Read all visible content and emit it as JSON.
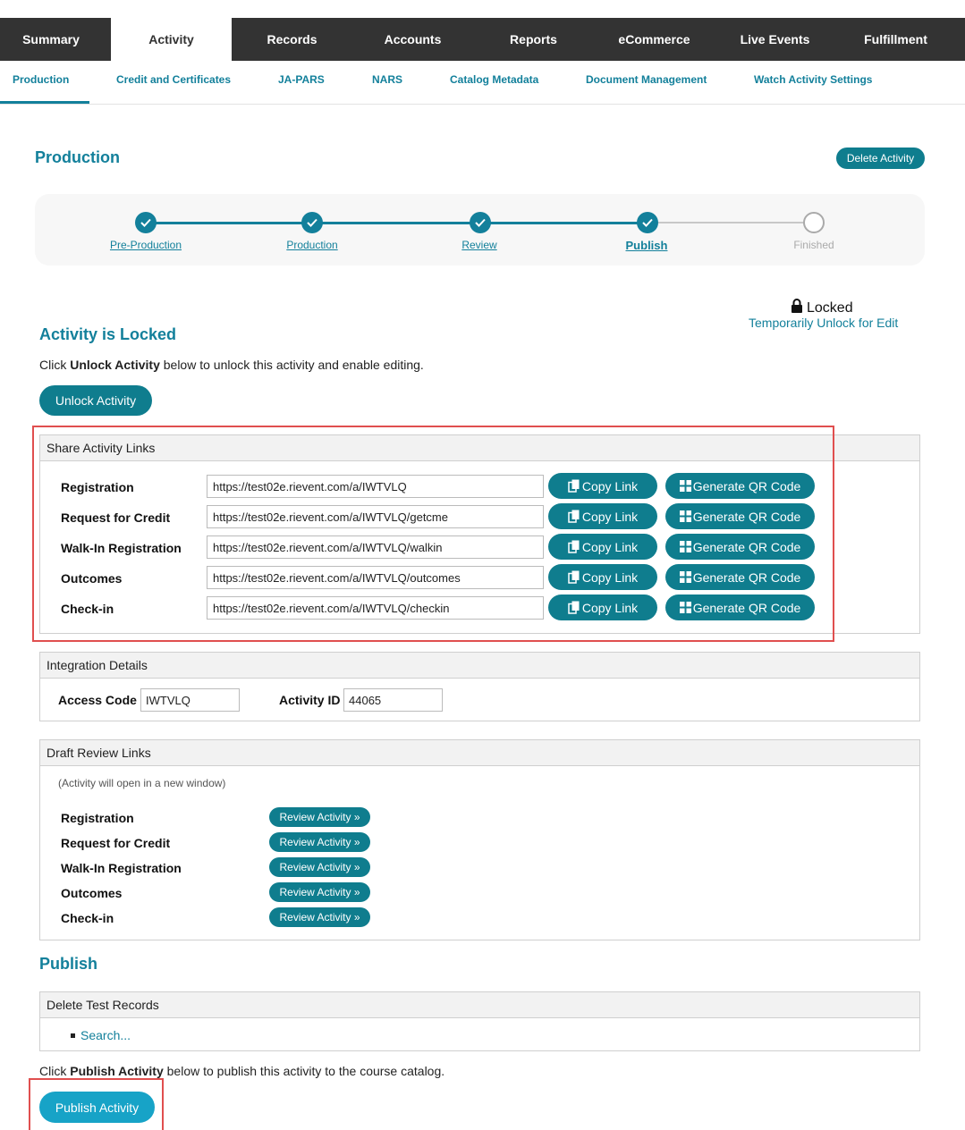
{
  "top_nav": [
    {
      "label": "Summary"
    },
    {
      "label": "Activity",
      "active": true
    },
    {
      "label": "Records"
    },
    {
      "label": "Accounts"
    },
    {
      "label": "Reports"
    },
    {
      "label": "eCommerce"
    },
    {
      "label": "Live Events"
    },
    {
      "label": "Fulfillment"
    }
  ],
  "sub_nav": [
    {
      "label": "Production",
      "active": true
    },
    {
      "label": "Credit and Certificates"
    },
    {
      "label": "JA-PARS"
    },
    {
      "label": "NARS"
    },
    {
      "label": "Catalog Metadata"
    },
    {
      "label": "Document Management"
    },
    {
      "label": "Watch Activity Settings"
    }
  ],
  "page": {
    "title": "Production",
    "delete_label": "Delete Activity"
  },
  "stepper": [
    {
      "label": "Pre-Production",
      "state": "done"
    },
    {
      "label": "Production",
      "state": "done"
    },
    {
      "label": "Review",
      "state": "done"
    },
    {
      "label": "Publish",
      "state": "current"
    },
    {
      "label": "Finished",
      "state": "pending"
    }
  ],
  "lock": {
    "status": "Locked",
    "unlock_link": "Temporarily Unlock for Edit",
    "heading": "Activity is Locked",
    "instruction_pre": "Click ",
    "instruction_bold": "Unlock Activity",
    "instruction_post": " below to unlock this activity and enable editing.",
    "unlock_button": "Unlock Activity"
  },
  "share_links": {
    "heading": "Share Activity Links",
    "copy_label": "Copy Link",
    "qr_label": "Generate QR Code",
    "rows": [
      {
        "label": "Registration",
        "url": "https://test02e.rievent.com/a/IWTVLQ"
      },
      {
        "label": "Request for Credit",
        "url": "https://test02e.rievent.com/a/IWTVLQ/getcme"
      },
      {
        "label": "Walk-In Registration",
        "url": "https://test02e.rievent.com/a/IWTVLQ/walkin"
      },
      {
        "label": "Outcomes",
        "url": "https://test02e.rievent.com/a/IWTVLQ/outcomes"
      },
      {
        "label": "Check-in",
        "url": "https://test02e.rievent.com/a/IWTVLQ/checkin"
      }
    ]
  },
  "integration": {
    "heading": "Integration Details",
    "access_code_label": "Access Code",
    "access_code": "IWTVLQ",
    "activity_id_label": "Activity ID",
    "activity_id": "44065"
  },
  "draft_review": {
    "heading": "Draft Review Links",
    "note": "(Activity will open in a new window)",
    "button_label": "Review Activity »",
    "rows": [
      {
        "label": "Registration"
      },
      {
        "label": "Request for Credit"
      },
      {
        "label": "Walk-In Registration"
      },
      {
        "label": "Outcomes"
      },
      {
        "label": "Check-in"
      }
    ]
  },
  "publish": {
    "heading": "Publish",
    "delete_test_heading": "Delete Test Records",
    "search_link": "Search...",
    "instruction_pre": "Click ",
    "instruction_bold": "Publish Activity",
    "instruction_post": " below to publish this activity to the course catalog.",
    "publish_button": "Publish Activity"
  },
  "colors": {
    "nav_bg": "#333333",
    "accent": "#13809b",
    "button": "#0f7d8e",
    "publish_button": "#17a3c7",
    "highlight": "#e04f4f"
  }
}
